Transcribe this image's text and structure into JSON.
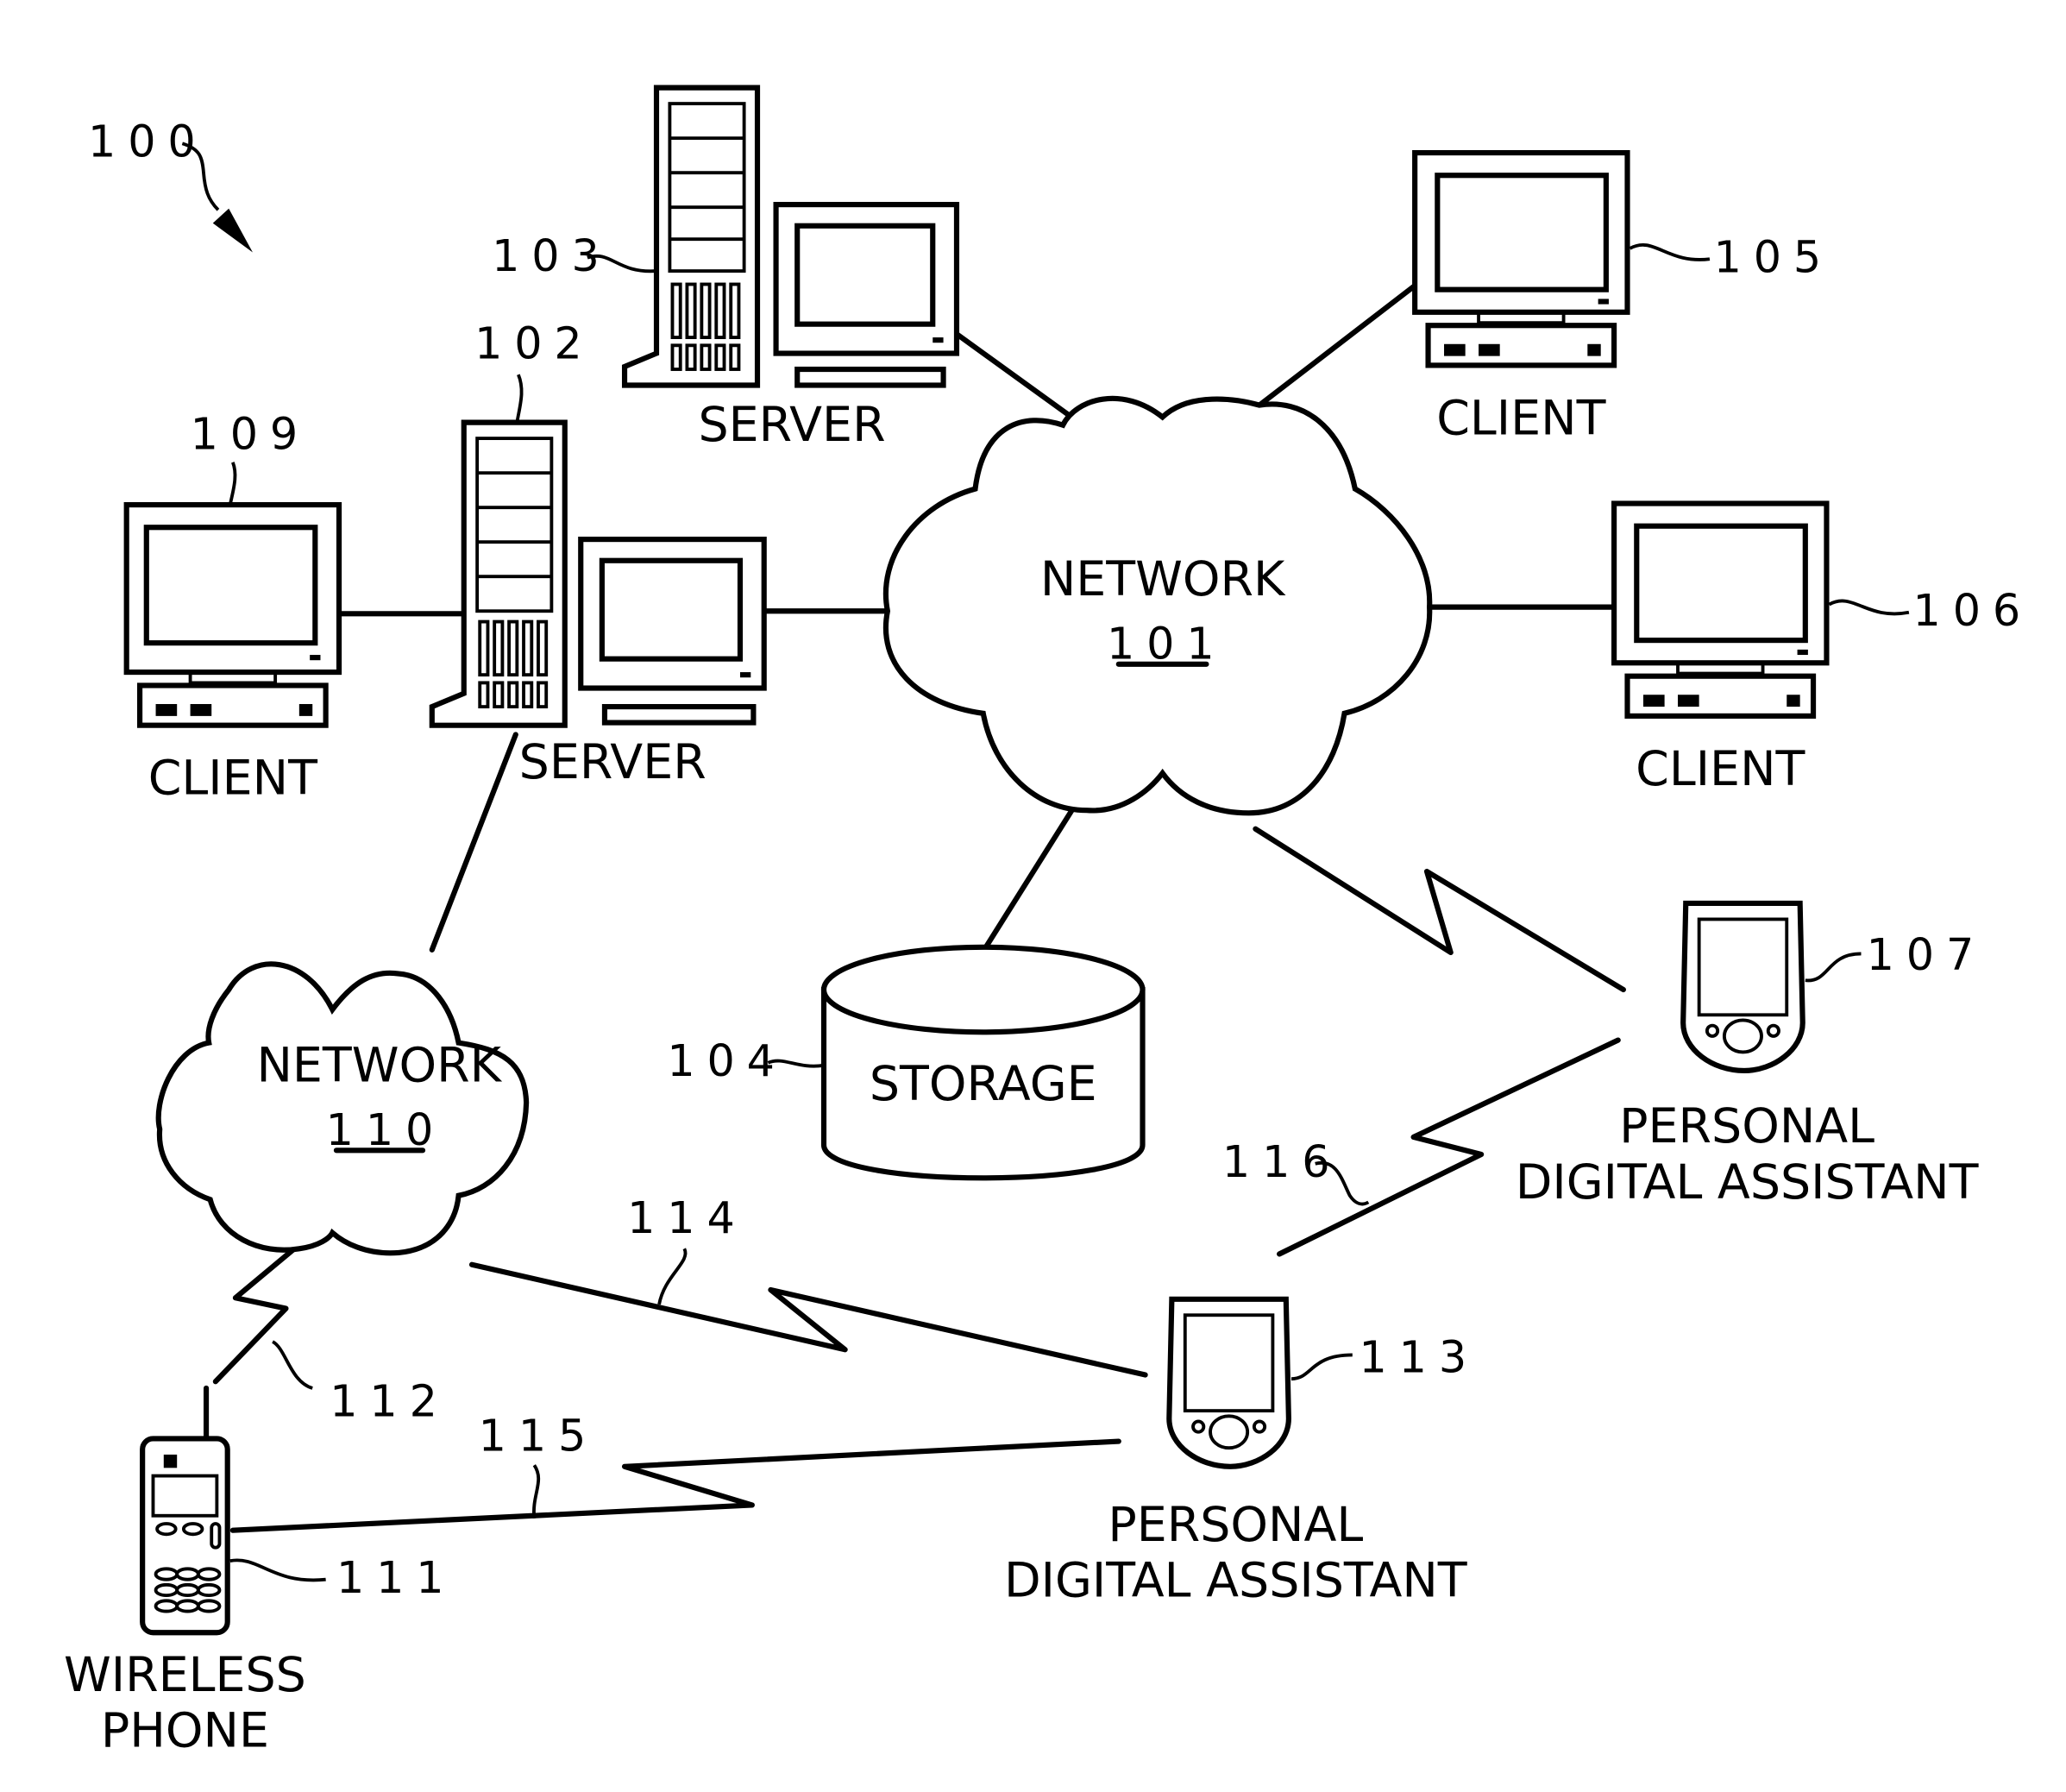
{
  "figure": {
    "ref": "100",
    "nodes": {
      "network_101": {
        "label": "NETWORK",
        "ref": "101"
      },
      "network_110": {
        "label": "NETWORK",
        "ref": "110"
      },
      "server_102": {
        "label": "SERVER",
        "ref": "102"
      },
      "server_103": {
        "label": "SERVER",
        "ref": "103"
      },
      "storage_104": {
        "label": "STORAGE",
        "ref": "104"
      },
      "client_105": {
        "label": "CLIENT",
        "ref": "105"
      },
      "client_106": {
        "label": "CLIENT",
        "ref": "106"
      },
      "client_109": {
        "label": "CLIENT",
        "ref": "109"
      },
      "pda_107": {
        "label_line1": "PERSONAL",
        "label_line2": "DIGITAL ASSISTANT",
        "ref": "107"
      },
      "pda_113": {
        "label_line1": "PERSONAL",
        "label_line2": "DIGITAL ASSISTANT",
        "ref": "113"
      },
      "phone_111": {
        "label_line1": "WIRELESS",
        "label_line2": "PHONE",
        "ref": "111"
      }
    },
    "links": {
      "wireless_112": {
        "ref": "112"
      },
      "wireless_114": {
        "ref": "114"
      },
      "wireless_115": {
        "ref": "115"
      },
      "wireless_116": {
        "ref": "116"
      }
    }
  }
}
